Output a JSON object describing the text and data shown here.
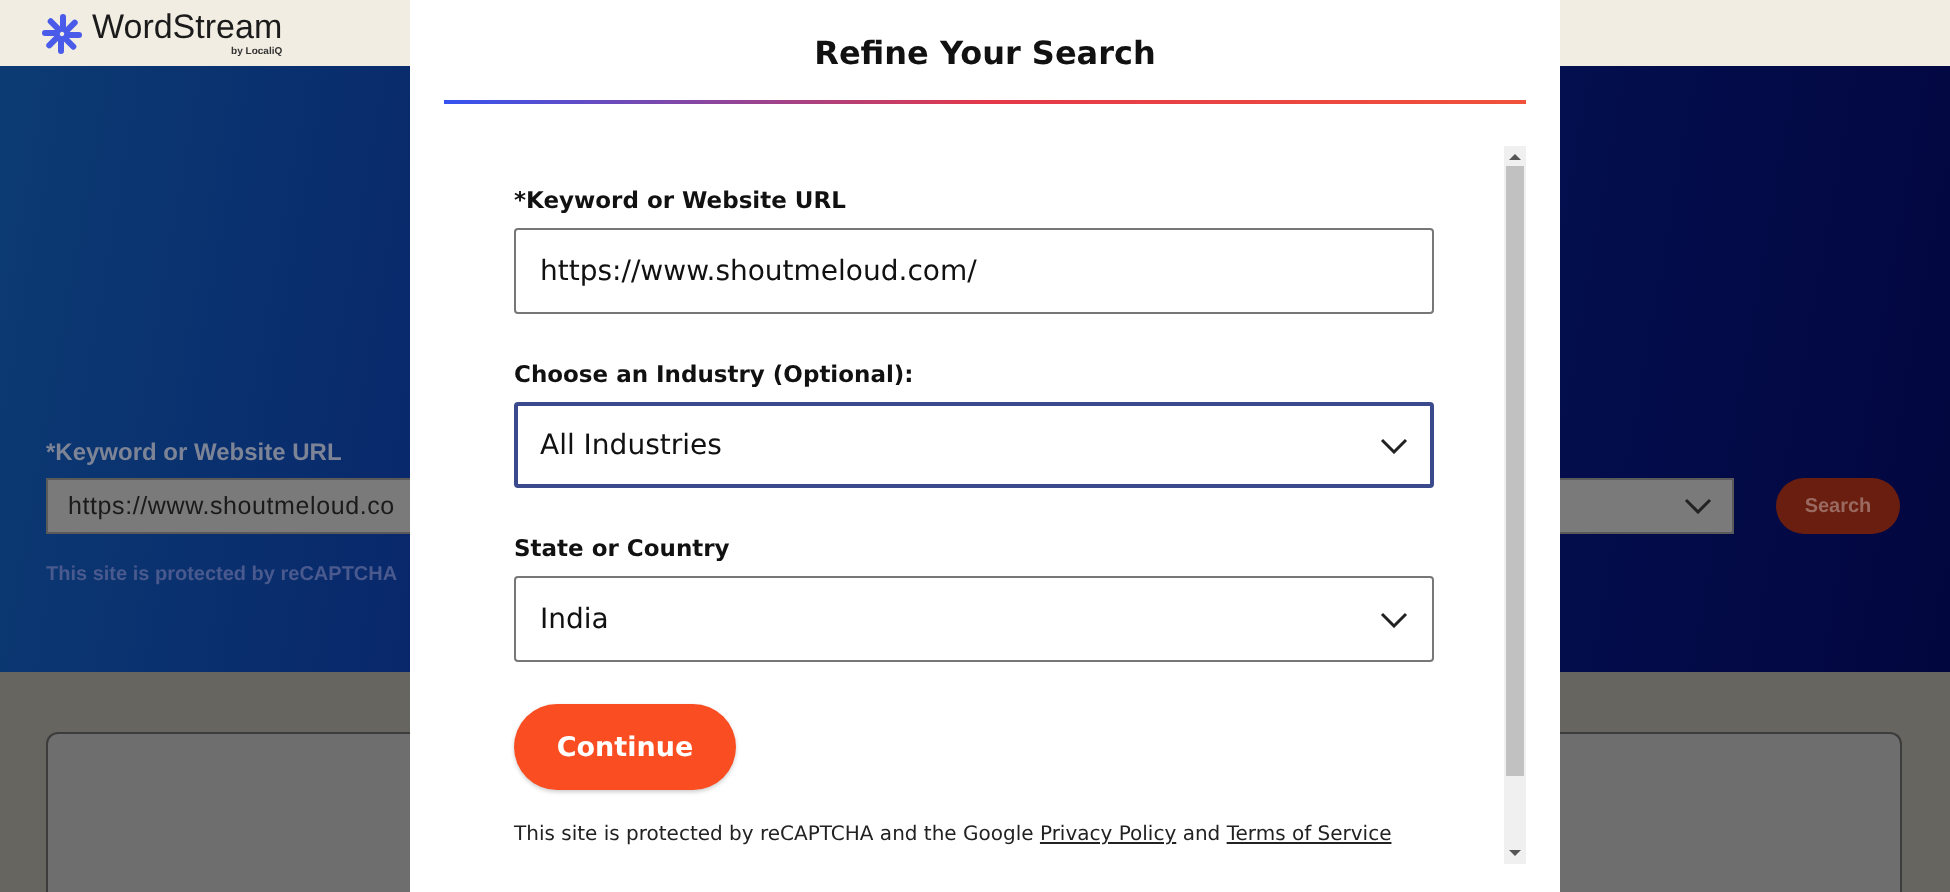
{
  "page": {
    "logo": {
      "name": "WordStream",
      "tagline": "by LocaliQ"
    },
    "search_form": {
      "label": "*Keyword or Website URL",
      "value": "https://www.shoutmeloud.co",
      "button": "Search",
      "notice": "This site is protected by reCAPTCHA"
    }
  },
  "dialog": {
    "title": "Refine Your Search",
    "fields": [
      {
        "kind": "input",
        "label": "*Keyword or Website URL",
        "value": "https://www.shoutmeloud.com/",
        "focused": false
      },
      {
        "kind": "select",
        "label": "Choose an Industry (Optional):",
        "value": "All Industries",
        "focused": true
      },
      {
        "kind": "select",
        "label": "State or Country",
        "value": "India",
        "focused": false
      }
    ],
    "button": "Continue",
    "notice": {
      "text": "This site is protected by reCAPTCHA and the Google",
      "links": [
        "Privacy Policy",
        "Terms of Service"
      ],
      "joiner": "and"
    }
  }
}
